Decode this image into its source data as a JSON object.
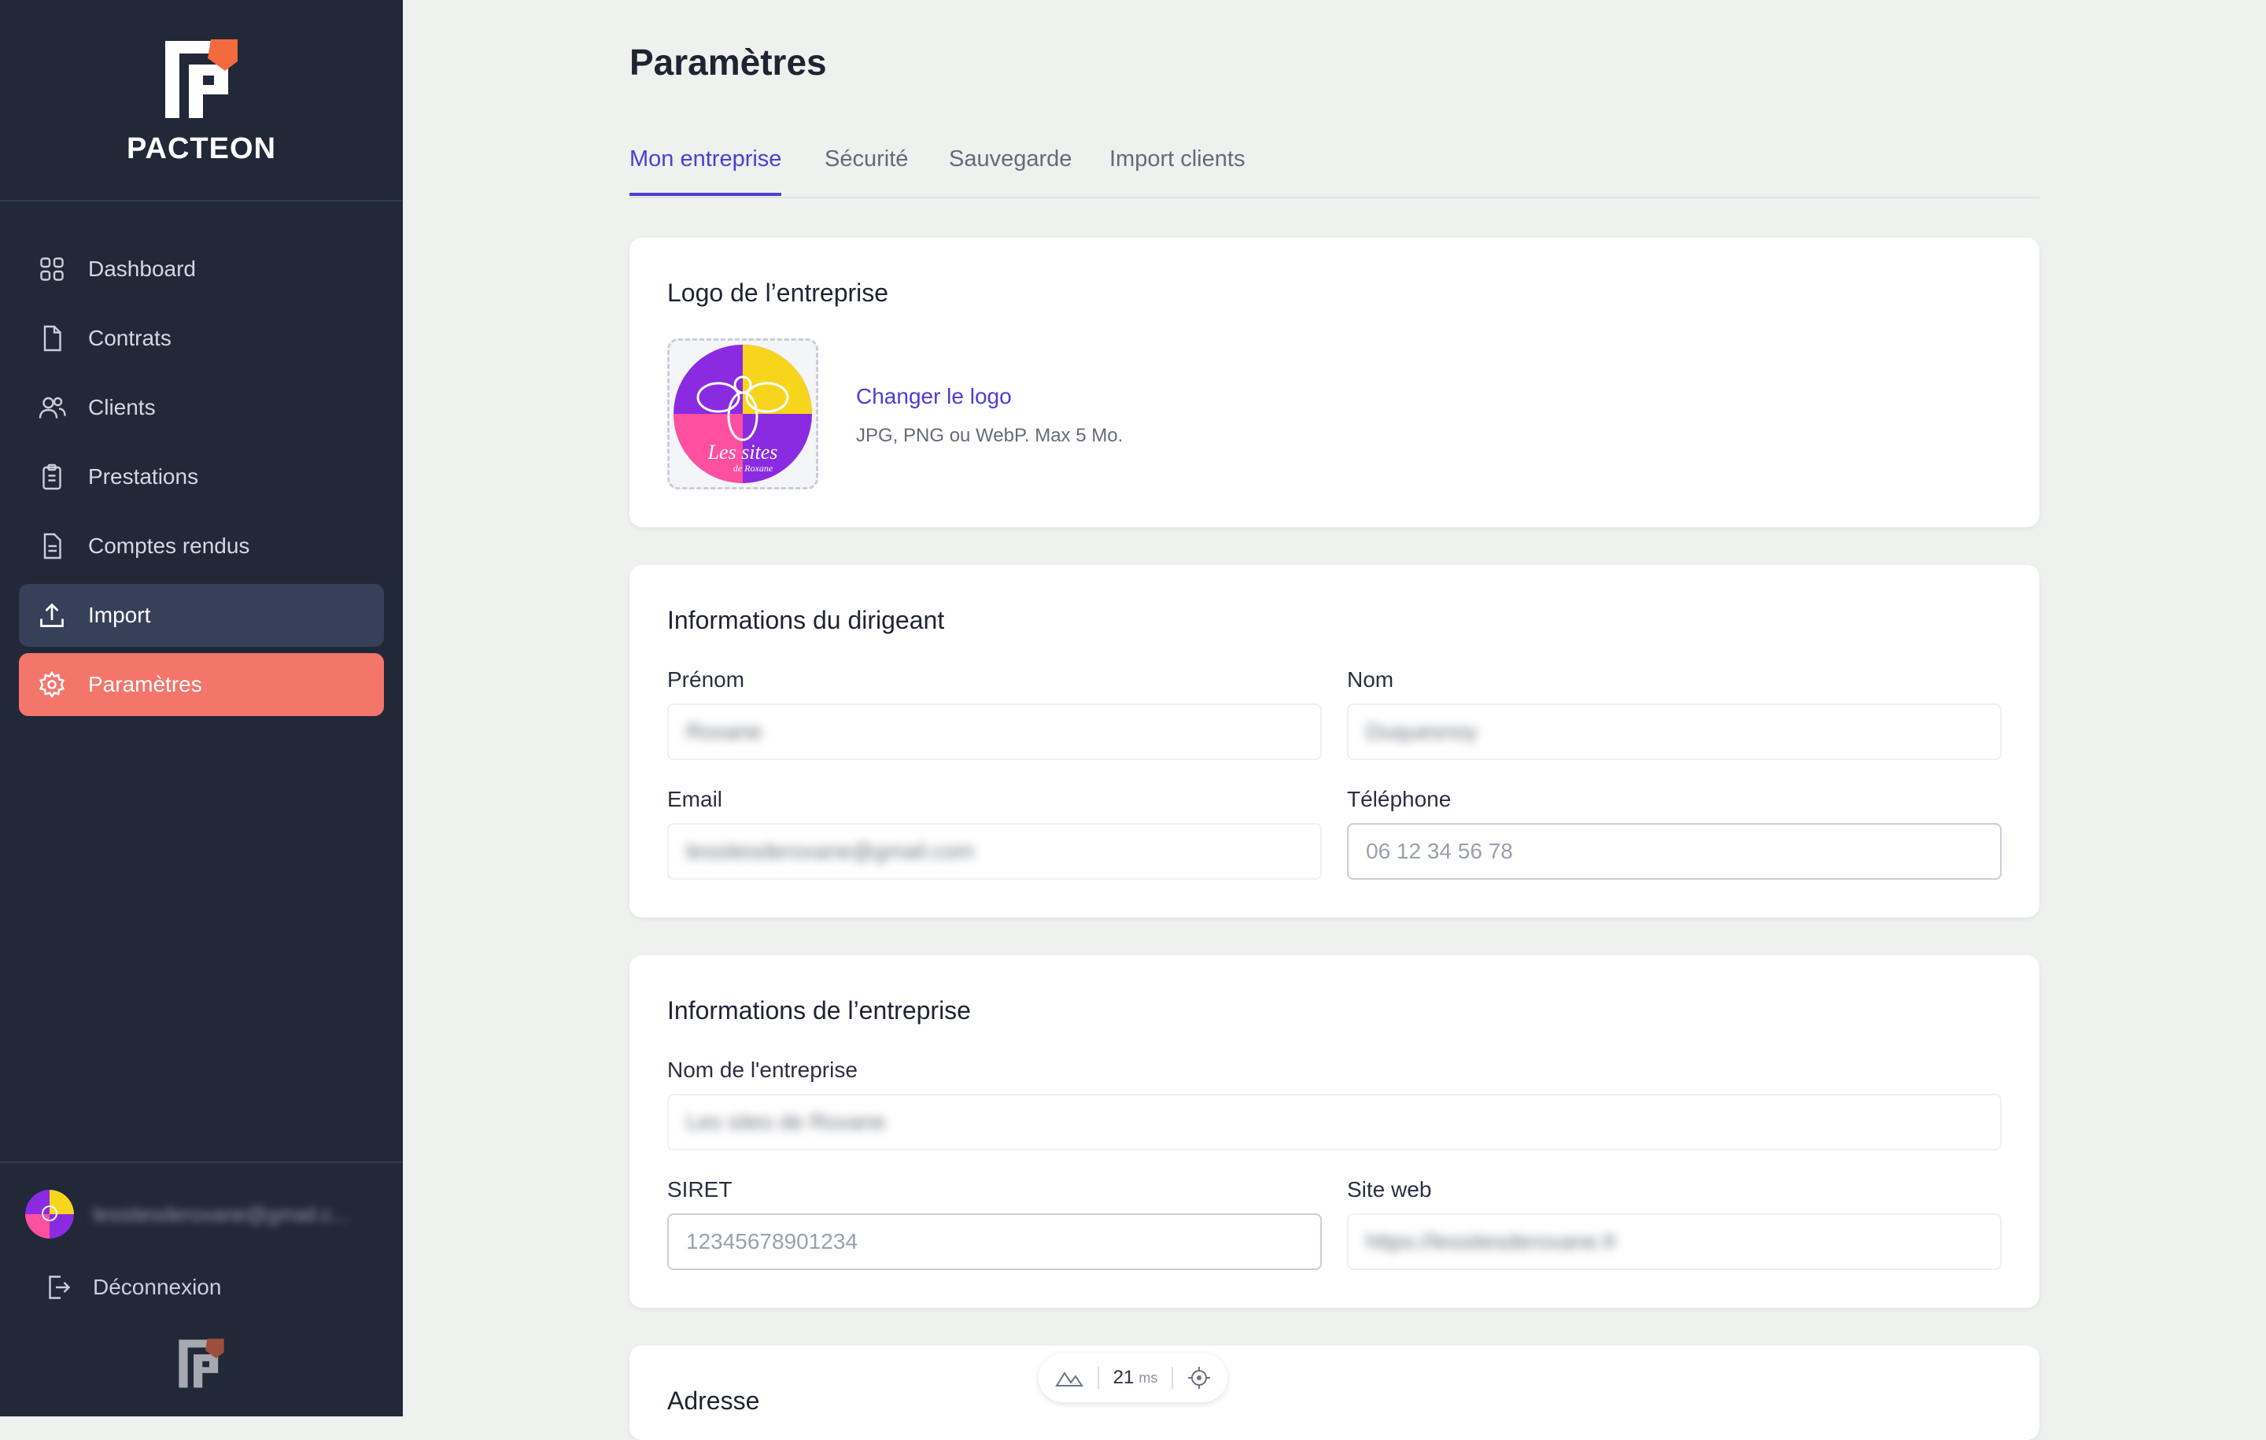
{
  "brand": {
    "name": "PACTEON",
    "accent": "#f4756a",
    "primary": "#4a3fd6"
  },
  "sidebar": {
    "items": [
      {
        "label": "Dashboard",
        "icon": "grid-icon"
      },
      {
        "label": "Contrats",
        "icon": "document-icon"
      },
      {
        "label": "Clients",
        "icon": "users-icon"
      },
      {
        "label": "Prestations",
        "icon": "clipboard-icon"
      },
      {
        "label": "Comptes rendus",
        "icon": "report-icon"
      },
      {
        "label": "Import",
        "icon": "upload-icon"
      },
      {
        "label": "Paramètres",
        "icon": "gear-icon"
      }
    ],
    "user_email": "lessitesderoxane@gmail.c...",
    "logout_label": "Déconnexion"
  },
  "page": {
    "title": "Paramètres",
    "tabs": [
      "Mon entreprise",
      "Sécurité",
      "Sauvegarde",
      "Import clients"
    ]
  },
  "logo_card": {
    "title": "Logo de l’entreprise",
    "change_label": "Changer le logo",
    "hint": "JPG, PNG ou WebP. Max 5 Mo.",
    "logo_text": "Les sites",
    "logo_subtext": "de Roxane"
  },
  "owner_card": {
    "title": "Informations du dirigeant",
    "first_name_label": "Prénom",
    "first_name_value": "Roxane",
    "last_name_label": "Nom",
    "last_name_value": "Duquesnoy",
    "email_label": "Email",
    "email_value": "lessitesderoxane@gmail.com",
    "phone_label": "Téléphone",
    "phone_placeholder": "06 12 34 56 78"
  },
  "company_card": {
    "title": "Informations de l’entreprise",
    "name_label": "Nom de l'entreprise",
    "name_value": "Les sites de Roxane",
    "siret_label": "SIRET",
    "siret_placeholder": "12345678901234",
    "website_label": "Site web",
    "website_value": "https://lessitesderoxane.fr"
  },
  "address_card": {
    "title": "Adresse"
  },
  "metrics": {
    "value": "21",
    "unit": "ms"
  }
}
